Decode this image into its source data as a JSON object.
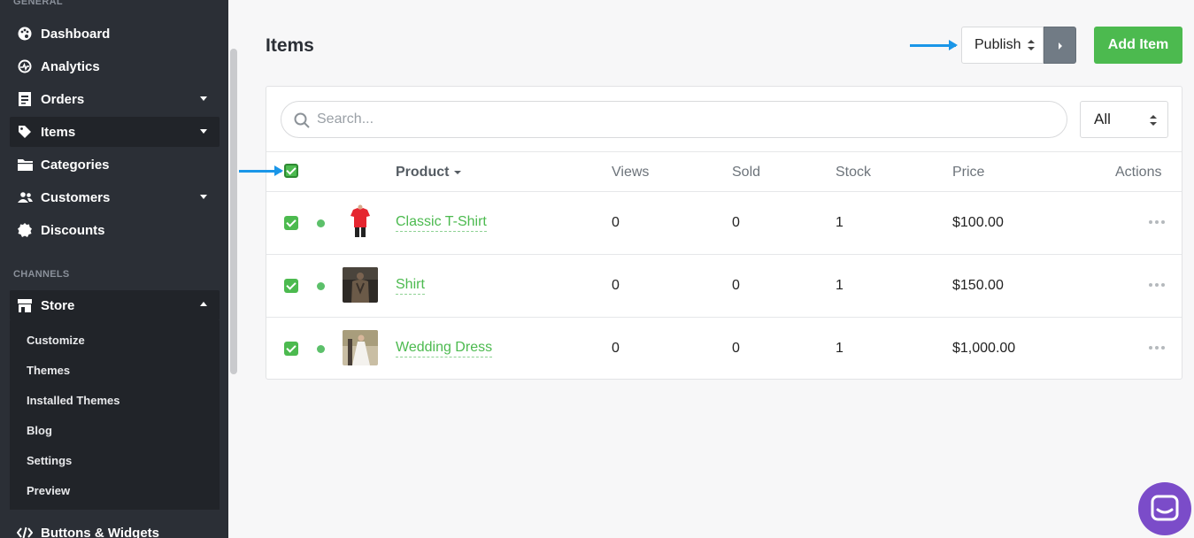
{
  "sidebar": {
    "general_title": "GENERAL",
    "items": [
      {
        "label": "Dashboard",
        "icon": "palette-icon"
      },
      {
        "label": "Analytics",
        "icon": "analytics-icon"
      },
      {
        "label": "Orders",
        "icon": "orders-icon"
      },
      {
        "label": "Items",
        "icon": "tag-icon"
      },
      {
        "label": "Categories",
        "icon": "folder-icon"
      },
      {
        "label": "Customers",
        "icon": "users-icon"
      },
      {
        "label": "Discounts",
        "icon": "badge-icon"
      }
    ],
    "channels_title": "CHANNELS",
    "store": {
      "label": "Store",
      "icon": "store-icon"
    },
    "store_subitems": [
      "Customize",
      "Themes",
      "Installed Themes",
      "Blog",
      "Settings",
      "Preview"
    ],
    "buttons_widgets": {
      "label": "Buttons & Widgets",
      "icon": "code-icon"
    }
  },
  "main": {
    "title": "Items",
    "publish_select": "Publish",
    "add_button": "Add Item",
    "search_placeholder": "Search...",
    "filter_select": "All",
    "columns": [
      "Product",
      "Views",
      "Sold",
      "Stock",
      "Price",
      "Actions"
    ],
    "rows": [
      {
        "name": "Classic T-Shirt",
        "views": "0",
        "sold": "0",
        "stock": "1",
        "price": "$100.00"
      },
      {
        "name": "Shirt",
        "views": "0",
        "sold": "0",
        "stock": "1",
        "price": "$150.00"
      },
      {
        "name": "Wedding Dress",
        "views": "0",
        "sold": "0",
        "stock": "1",
        "price": "$1,000.00"
      }
    ]
  },
  "colors": {
    "sidebar_bg": "#2b2f36",
    "accent_green": "#4cba4f",
    "arrow_blue": "#1a96e8",
    "chat_purple": "#7b4cc9"
  }
}
